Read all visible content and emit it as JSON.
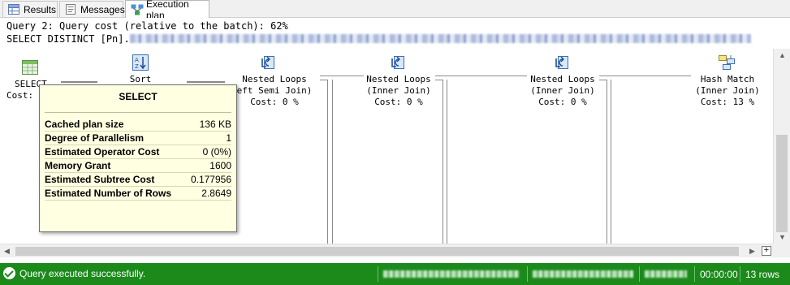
{
  "tabs": [
    {
      "label": "Results",
      "icon": "grid-icon",
      "active": false
    },
    {
      "label": "Messages",
      "icon": "messages-icon",
      "active": false
    },
    {
      "label": "Execution plan",
      "icon": "execution-plan-icon",
      "active": true
    }
  ],
  "query": {
    "cost_line": "Query 2: Query cost (relative to the batch): 62%",
    "sql_prefix": "SELECT DISTINCT [Pn]."
  },
  "plan": {
    "select": {
      "name": "SELECT",
      "cost": "Cost:"
    },
    "sort": {
      "name": "Sort"
    },
    "nested1": {
      "name": "Nested Loops",
      "sub": "eft Semi Join)",
      "cost": "Cost: 0 %"
    },
    "nested2": {
      "name": "Nested Loops",
      "sub": "(Inner Join)",
      "cost": "Cost: 0 %"
    },
    "nested3": {
      "name": "Nested Loops",
      "sub": "(Inner Join)",
      "cost": "Cost: 0 %"
    },
    "hash": {
      "name": "Hash Match",
      "sub": "(Inner Join)",
      "cost": "Cost: 13 %"
    }
  },
  "tooltip": {
    "title": "SELECT",
    "rows": [
      {
        "label": "Cached plan size",
        "value": "136 KB"
      },
      {
        "label": "Degree of Parallelism",
        "value": "1"
      },
      {
        "label": "Estimated Operator Cost",
        "value": "0 (0%)"
      },
      {
        "label": "Memory Grant",
        "value": "1600"
      },
      {
        "label": "Estimated Subtree Cost",
        "value": "0.177956"
      },
      {
        "label": "Estimated Number of Rows",
        "value": "2.8649"
      }
    ]
  },
  "status": {
    "message": "Query executed successfully.",
    "time": "00:00:00",
    "rows": "13 rows",
    "bar_color": "#1b8a1b"
  }
}
